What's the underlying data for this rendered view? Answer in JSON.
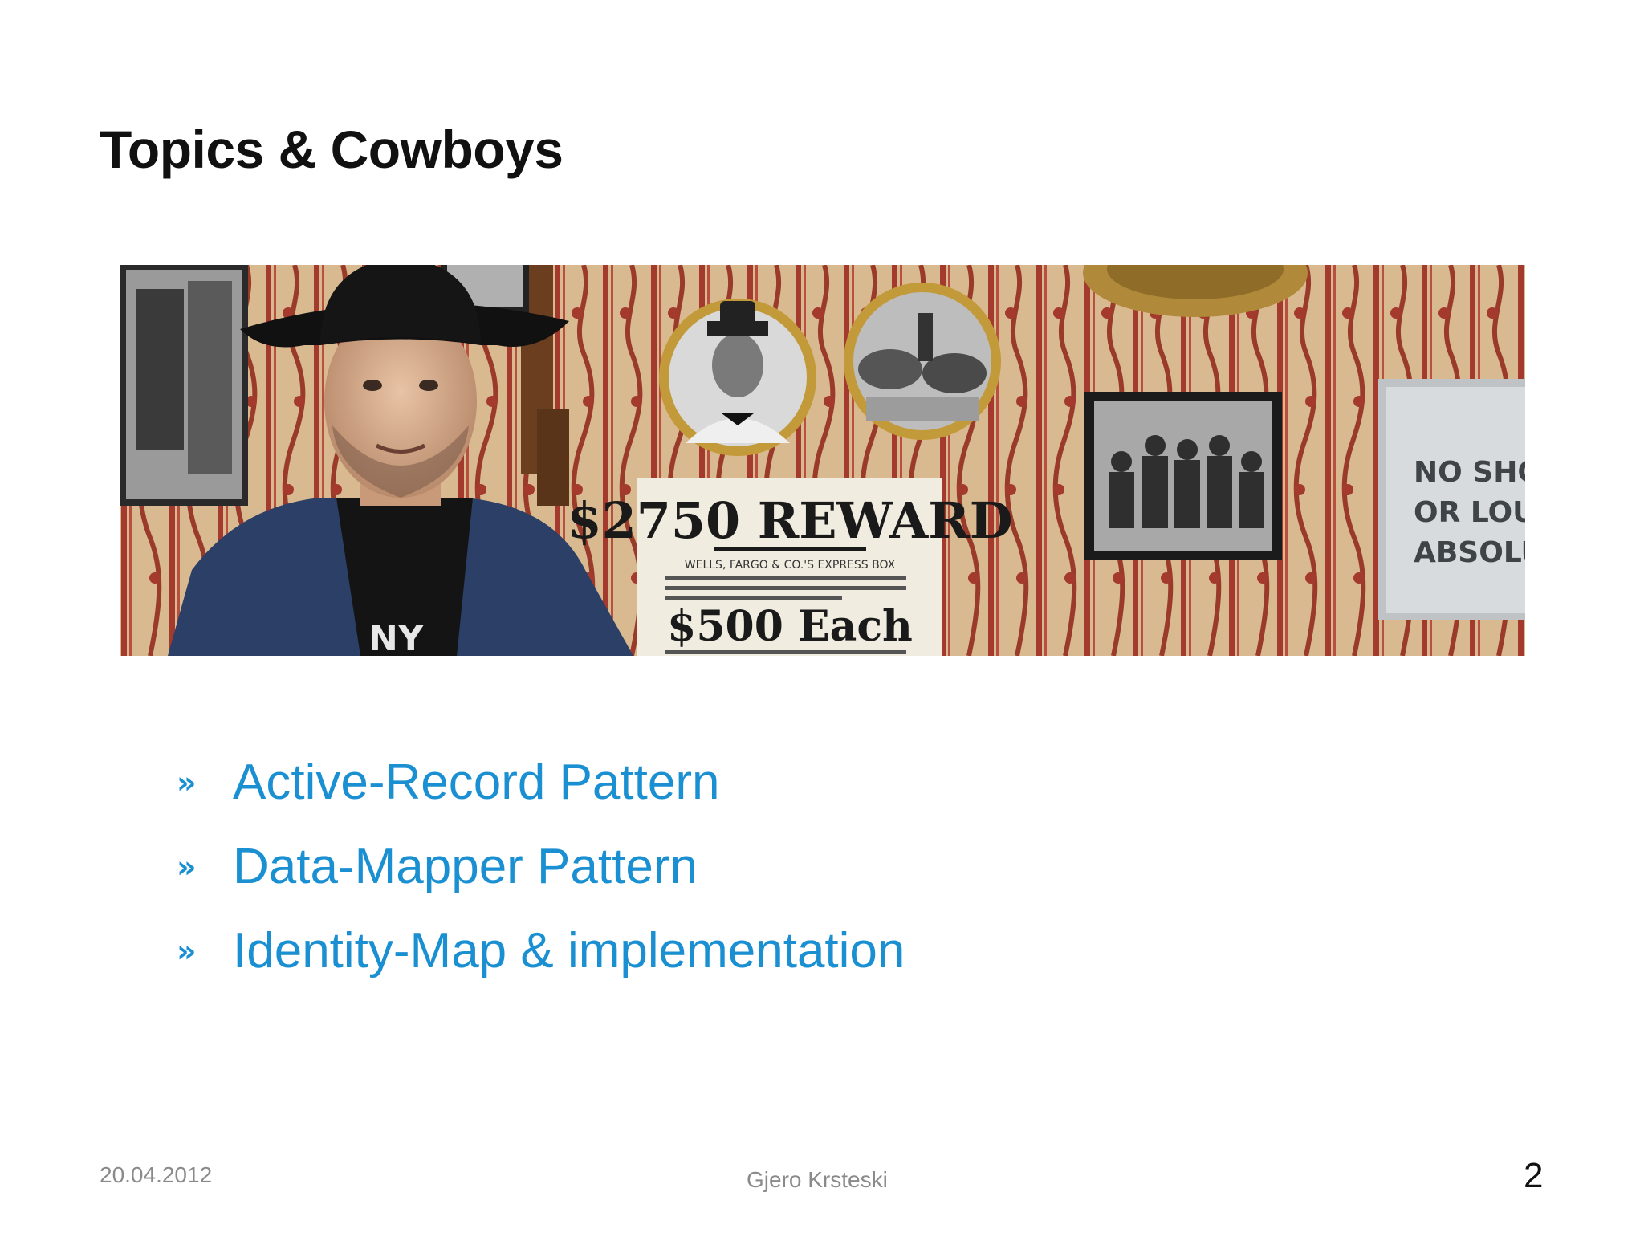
{
  "slide": {
    "title": "Topics & Cowboys",
    "bullets": [
      {
        "marker": "»",
        "text": "Active-Record Pattern"
      },
      {
        "marker": "»",
        "text": "Data-Mapper Pattern"
      },
      {
        "marker": "»",
        "text": "Identity-Map & implementation"
      }
    ],
    "footer": {
      "date": "20.04.2012",
      "author": "Gjero Krsteski",
      "page_number": "2"
    },
    "photo": {
      "reward_headline": "$2750 REWARD",
      "reward_line1": "WELLS, FARGO & CO.'S EXPRESS BOX",
      "reward_amount": "$500 Each",
      "sign_line1": "NO SHOOT",
      "sign_line2": "OR LOUD",
      "sign_line3": "ABSOLUTE",
      "shirt_text": "NY"
    },
    "colors": {
      "accent": "#1a8fd1",
      "title": "#111111",
      "footer": "#8a8a8a"
    }
  }
}
